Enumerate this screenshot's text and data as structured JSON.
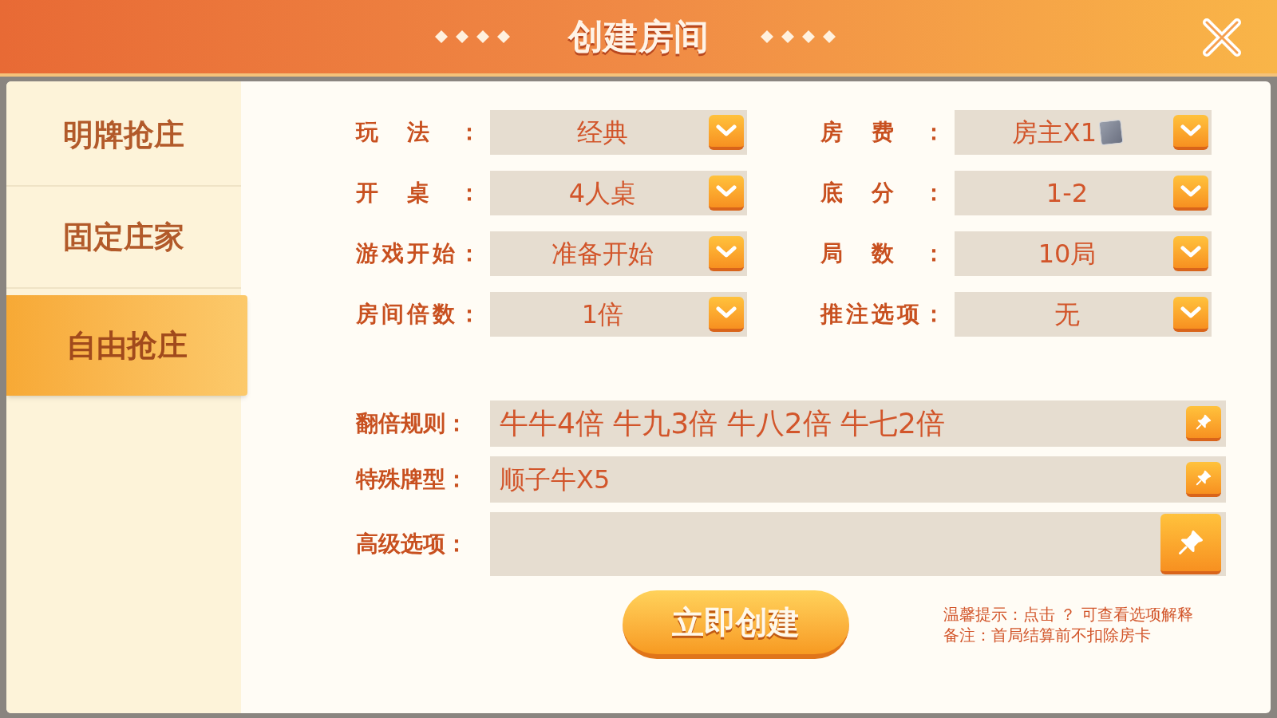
{
  "title": "创建房间",
  "sidebar": {
    "items": [
      {
        "label": "明牌抢庄",
        "selected": false
      },
      {
        "label": "固定庄家",
        "selected": false
      },
      {
        "label": "自由抢庄",
        "selected": true
      }
    ]
  },
  "options": [
    {
      "label": "玩法：",
      "value": "经典"
    },
    {
      "label": "房费：",
      "value": "房主X1",
      "card_icon": true
    },
    {
      "label": "开桌：",
      "value": "4人桌"
    },
    {
      "label": "底分：",
      "value": "1-2"
    },
    {
      "label": "游戏开始：",
      "value": "准备开始"
    },
    {
      "label": "局数：",
      "value": "10局"
    },
    {
      "label": "房间倍数：",
      "value": "1倍"
    },
    {
      "label": "推注选项：",
      "value": "无"
    }
  ],
  "rules": [
    {
      "label": "翻倍规则：",
      "value": "牛牛4倍 牛九3倍 牛八2倍 牛七2倍",
      "kind": "large"
    },
    {
      "label": "特殊牌型：",
      "value": "顺子牛X5",
      "kind": "normal"
    },
    {
      "label": "高级选项：",
      "kind": "tall"
    }
  ],
  "create_button": "立即创建",
  "tips": [
    "温馨提示：点击 ？ 可查看选项解释",
    "备注：首局结算前不扣除房卡"
  ]
}
